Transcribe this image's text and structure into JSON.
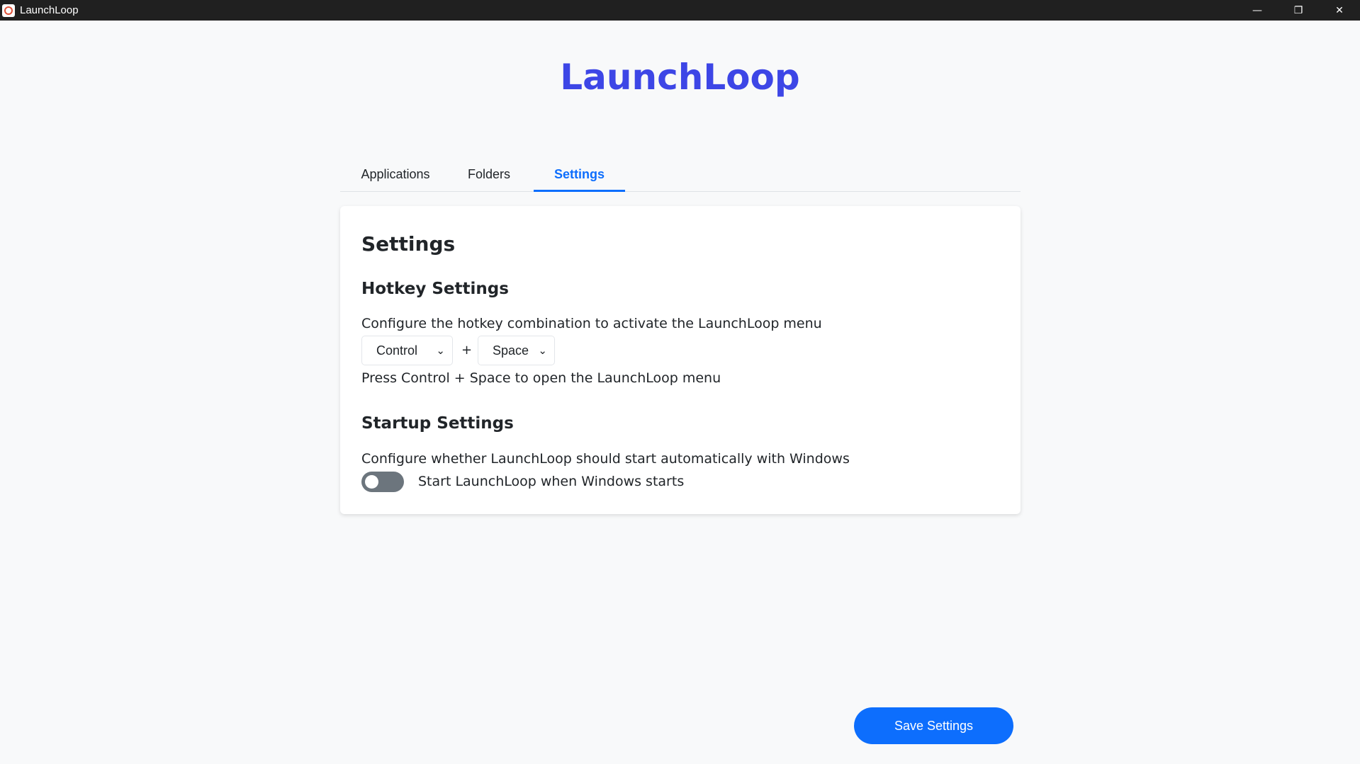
{
  "window": {
    "title": "LaunchLoop",
    "minimize_glyph": "—",
    "restore_glyph": "❐",
    "close_glyph": "✕"
  },
  "app": {
    "title": "LaunchLoop"
  },
  "tabs": [
    {
      "label": "Applications",
      "active": false
    },
    {
      "label": "Folders",
      "active": false
    },
    {
      "label": "Settings",
      "active": true
    }
  ],
  "settings": {
    "title": "Settings",
    "hotkey": {
      "title": "Hotkey Settings",
      "description": "Configure the hotkey combination to activate the LaunchLoop menu",
      "modifier_value": "Control",
      "plus": "+",
      "key_value": "Space",
      "hint": "Press Control + Space to open the LaunchLoop menu"
    },
    "startup": {
      "title": "Startup Settings",
      "description": "Configure whether LaunchLoop should start automatically with Windows",
      "toggle_label": "Start LaunchLoop when Windows starts",
      "toggle_on": false
    }
  },
  "actions": {
    "save_label": "Save Settings"
  },
  "icons": {
    "chevron": "⌄"
  },
  "colors": {
    "title": "#3d46e6",
    "accent": "#0d6efd",
    "titlebar": "#202020",
    "toggle_off": "#6c757d"
  }
}
